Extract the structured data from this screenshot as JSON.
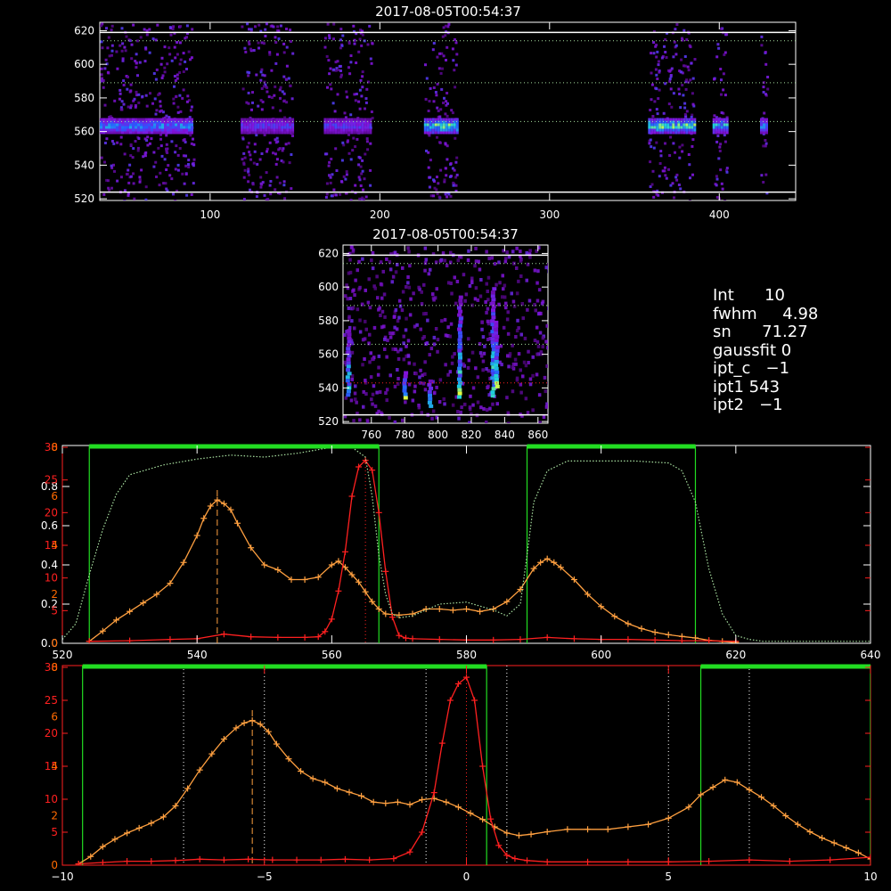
{
  "colors": {
    "background": "#000000",
    "axis": "#ffffff",
    "axis_red": "#ff2020",
    "axis_orange": "#ff6a00",
    "profile_orange": "#ffa040",
    "profile_red": "#ff2020",
    "filter_green": "#22dd22",
    "filter_dotted": "#a8e0a0"
  },
  "stats": [
    {
      "label": "Int",
      "value": "10",
      "text": "Int      10"
    },
    {
      "label": "fwhm",
      "value": "4.98",
      "text": "fwhm     4.98"
    },
    {
      "label": "sn",
      "value": "71.27",
      "text": "sn      71.27"
    },
    {
      "label": "gaussfit",
      "value": "0",
      "text": "gaussfit 0"
    },
    {
      "label": "ipt_c",
      "value": "-1",
      "text": "ipt_c   −1"
    },
    {
      "label": "ipt1",
      "value": "543",
      "text": "ipt1 543"
    },
    {
      "label": "ipt2",
      "value": "-1",
      "text": "ipt2   −1"
    }
  ],
  "chart_data": [
    {
      "id": "spectrogram-top",
      "type": "heatmap",
      "title": "2017-08-05T00:54:37",
      "xlim": [
        35,
        445
      ],
      "ylim": [
        519,
        625
      ],
      "x_ticks": [
        "100",
        "200",
        "300",
        "400"
      ],
      "x_tick_values": [
        100,
        200,
        300,
        400
      ],
      "y_ticks": [
        "520",
        "540",
        "560",
        "580",
        "600",
        "620"
      ],
      "y_tick_values": [
        520,
        540,
        560,
        580,
        600,
        620
      ],
      "bright_band_y": [
        560,
        568
      ],
      "blocks": [
        {
          "x": [
            35,
            90
          ],
          "intensity": 0.7
        },
        {
          "x": [
            118,
            148
          ],
          "intensity": 0.5
        },
        {
          "x": [
            167,
            195
          ],
          "intensity": 0.5
        },
        {
          "x": [
            226,
            245
          ],
          "intensity": 0.9
        },
        {
          "x": [
            358,
            385
          ],
          "intensity": 0.9
        },
        {
          "x": [
            396,
            404
          ],
          "intensity": 0.8
        },
        {
          "x": [
            424,
            428
          ],
          "intensity": 0.7
        }
      ],
      "guide_lines_y": [
        589,
        566,
        614
      ],
      "white_lines_y": [
        524,
        619
      ]
    },
    {
      "id": "spectrogram-small",
      "type": "heatmap",
      "title": "2017-08-05T00:54:37",
      "xlim": [
        743,
        866
      ],
      "ylim": [
        519,
        625
      ],
      "x_ticks": [
        "760",
        "780",
        "800",
        "820",
        "840",
        "860"
      ],
      "x_tick_values": [
        760,
        780,
        800,
        820,
        840,
        860
      ],
      "y_ticks": [
        "520",
        "540",
        "560",
        "580",
        "600",
        "620"
      ],
      "y_tick_values": [
        520,
        540,
        560,
        580,
        600,
        620
      ],
      "streaks": [
        {
          "x": 746,
          "y": [
            535,
            575
          ]
        },
        {
          "x": 780,
          "y": [
            535,
            550
          ]
        },
        {
          "x": 795,
          "y": [
            530,
            545
          ]
        },
        {
          "x": 813,
          "y": [
            535,
            595
          ]
        },
        {
          "x": 833,
          "y": [
            535,
            600
          ]
        },
        {
          "x": 835,
          "y": [
            540,
            580
          ]
        }
      ],
      "guide_lines_y": [
        589,
        566,
        614
      ],
      "white_lines_y": [
        524,
        619
      ]
    },
    {
      "id": "profile-wavelength",
      "type": "line",
      "xlim": [
        520,
        640
      ],
      "x_ticks": [
        "520",
        "540",
        "560",
        "580",
        "600",
        "620",
        "640"
      ],
      "x_tick_values": [
        520,
        540,
        560,
        580,
        600,
        620,
        640
      ],
      "y_left_black_ticks": [
        "0.0",
        "0.2",
        "0.4",
        "0.6",
        "0.8"
      ],
      "y_left_black_values": [
        0.0,
        0.2,
        0.4,
        0.6,
        0.8
      ],
      "y_left_black_range": [
        0,
        1.0
      ],
      "y_left_red_ticks": [
        "5",
        "10",
        "15",
        "20",
        "25",
        "30"
      ],
      "y_left_red_values": [
        5,
        10,
        15,
        20,
        25,
        30
      ],
      "y_left_red_range": [
        0,
        30
      ],
      "y_left_orange_ticks": [
        "0",
        "2",
        "4",
        "6",
        "8"
      ],
      "y_left_orange_values": [
        0,
        2,
        4,
        6,
        8
      ],
      "y_left_orange_range": [
        0,
        8
      ],
      "filter_bands": [
        [
          524,
          567
        ],
        [
          589,
          614
        ]
      ],
      "marker_dashed_x": 543,
      "marker_dotted_x": 565,
      "series": [
        {
          "id": "orange",
          "axis": "orange",
          "x": [
            524,
            526,
            528,
            530,
            532,
            534,
            536,
            538,
            540,
            541,
            542,
            543,
            544,
            545,
            546,
            548,
            550,
            552,
            554,
            556,
            558,
            560,
            561,
            562,
            563,
            564,
            565,
            566,
            567,
            568,
            570,
            572,
            574,
            576,
            578,
            580,
            582,
            584,
            586,
            588,
            590,
            591,
            592,
            593,
            594,
            596,
            598,
            600,
            602,
            604,
            606,
            608,
            610,
            612,
            614,
            616,
            618,
            620
          ],
          "y": [
            0.08,
            0.5,
            0.95,
            1.3,
            1.65,
            2.0,
            2.45,
            3.3,
            4.4,
            5.1,
            5.6,
            5.85,
            5.7,
            5.45,
            4.9,
            3.9,
            3.2,
            3.0,
            2.6,
            2.6,
            2.7,
            3.2,
            3.35,
            3.1,
            2.8,
            2.5,
            2.1,
            1.7,
            1.4,
            1.2,
            1.15,
            1.2,
            1.4,
            1.4,
            1.35,
            1.4,
            1.3,
            1.4,
            1.7,
            2.2,
            3.05,
            3.3,
            3.45,
            3.3,
            3.1,
            2.6,
            2.0,
            1.5,
            1.1,
            0.8,
            0.6,
            0.45,
            0.35,
            0.28,
            0.22,
            0.12,
            0.08,
            0.03
          ]
        },
        {
          "id": "red",
          "axis": "red",
          "x": [
            524,
            530,
            536,
            540,
            544,
            548,
            552,
            556,
            558,
            559,
            560,
            561,
            562,
            563,
            564,
            565,
            566,
            567,
            568,
            569,
            570,
            571,
            572,
            576,
            580,
            584,
            588,
            592,
            596,
            600,
            604,
            608,
            612,
            616,
            620
          ],
          "y": [
            0.3,
            0.4,
            0.6,
            0.7,
            1.4,
            1.0,
            0.9,
            0.9,
            1.0,
            1.8,
            3.7,
            8.0,
            14.0,
            22.5,
            27.0,
            28.0,
            26.5,
            20.0,
            11.0,
            4.0,
            1.2,
            0.8,
            0.7,
            0.6,
            0.5,
            0.5,
            0.6,
            0.9,
            0.7,
            0.6,
            0.6,
            0.5,
            0.4,
            0.4,
            0.3
          ]
        },
        {
          "id": "filter-transmission",
          "axis": "black",
          "x": [
            520,
            522,
            524,
            526,
            528,
            530,
            535,
            540,
            545,
            550,
            555,
            560,
            563,
            565,
            566,
            567,
            568,
            569,
            570,
            572,
            576,
            580,
            584,
            586,
            588,
            589,
            590,
            592,
            595,
            600,
            605,
            610,
            612,
            614,
            616,
            618,
            620,
            622,
            624,
            630,
            640
          ],
          "y": [
            0.02,
            0.1,
            0.35,
            0.58,
            0.76,
            0.86,
            0.91,
            0.94,
            0.96,
            0.95,
            0.97,
            1.0,
            1.0,
            0.95,
            0.75,
            0.45,
            0.25,
            0.15,
            0.13,
            0.14,
            0.2,
            0.21,
            0.17,
            0.14,
            0.2,
            0.45,
            0.72,
            0.88,
            0.93,
            0.93,
            0.93,
            0.92,
            0.88,
            0.72,
            0.38,
            0.15,
            0.04,
            0.02,
            0.01,
            0.01,
            0.01
          ]
        }
      ]
    },
    {
      "id": "profile-offset",
      "type": "line",
      "xlim": [
        -10,
        10
      ],
      "x_ticks": [
        "−10",
        "−5",
        "0",
        "5",
        "10"
      ],
      "x_tick_values": [
        -10,
        -5,
        0,
        5,
        10
      ],
      "y_left_red_ticks": [
        "5",
        "10",
        "15",
        "20",
        "25",
        "30"
      ],
      "y_left_red_values": [
        5,
        10,
        15,
        20,
        25,
        30
      ],
      "y_left_red_range": [
        0,
        30
      ],
      "y_left_orange_ticks": [
        "0",
        "2",
        "4",
        "6",
        "8"
      ],
      "y_left_orange_values": [
        0,
        2,
        4,
        6,
        8
      ],
      "y_left_orange_range": [
        0,
        8
      ],
      "filter_bands": [
        [
          -9.5,
          0.5
        ],
        [
          5.8,
          10
        ]
      ],
      "dotted_vlines_x": [
        -7,
        -5,
        -1,
        1,
        5,
        7
      ],
      "marker_dashed_x": -5.3,
      "marker_dotted_x": 0,
      "series": [
        {
          "id": "orange",
          "axis": "orange",
          "x": [
            -9.6,
            -9.3,
            -9.0,
            -8.7,
            -8.4,
            -8.1,
            -7.8,
            -7.5,
            -7.2,
            -6.9,
            -6.6,
            -6.3,
            -6.0,
            -5.7,
            -5.5,
            -5.3,
            -5.1,
            -4.9,
            -4.7,
            -4.4,
            -4.1,
            -3.8,
            -3.5,
            -3.2,
            -2.9,
            -2.6,
            -2.3,
            -2.0,
            -1.7,
            -1.4,
            -1.1,
            -0.8,
            -0.5,
            -0.2,
            0.1,
            0.4,
            0.7,
            1.0,
            1.3,
            1.6,
            2.0,
            2.5,
            3.0,
            3.5,
            4.0,
            4.5,
            5.0,
            5.5,
            5.8,
            6.1,
            6.4,
            6.7,
            7.0,
            7.3,
            7.6,
            7.9,
            8.2,
            8.5,
            8.8,
            9.1,
            9.4,
            9.7,
            10.0
          ],
          "y": [
            0.05,
            0.35,
            0.75,
            1.05,
            1.3,
            1.5,
            1.7,
            1.95,
            2.4,
            3.1,
            3.85,
            4.5,
            5.1,
            5.55,
            5.75,
            5.85,
            5.7,
            5.4,
            4.9,
            4.3,
            3.8,
            3.5,
            3.35,
            3.1,
            2.95,
            2.8,
            2.55,
            2.5,
            2.55,
            2.45,
            2.65,
            2.7,
            2.55,
            2.35,
            2.1,
            1.85,
            1.55,
            1.3,
            1.2,
            1.25,
            1.35,
            1.45,
            1.45,
            1.45,
            1.55,
            1.65,
            1.9,
            2.35,
            2.85,
            3.15,
            3.45,
            3.35,
            3.05,
            2.75,
            2.4,
            2.0,
            1.65,
            1.35,
            1.1,
            0.9,
            0.7,
            0.5,
            0.25
          ]
        },
        {
          "id": "red",
          "axis": "red",
          "x": [
            -9.6,
            -9.0,
            -8.4,
            -7.8,
            -7.2,
            -6.6,
            -6.0,
            -5.4,
            -4.8,
            -4.2,
            -3.6,
            -3.0,
            -2.4,
            -1.8,
            -1.4,
            -1.1,
            -0.8,
            -0.6,
            -0.4,
            -0.2,
            0.0,
            0.2,
            0.4,
            0.6,
            0.8,
            1.0,
            1.2,
            1.5,
            2.0,
            3.0,
            4.0,
            5.0,
            6.0,
            7.0,
            8.0,
            9.0,
            10.0
          ],
          "y": [
            0.2,
            0.4,
            0.6,
            0.6,
            0.7,
            0.9,
            0.8,
            0.9,
            0.8,
            0.8,
            0.8,
            0.9,
            0.8,
            1.0,
            2.0,
            5.0,
            11.0,
            18.5,
            25.0,
            27.5,
            28.5,
            25.0,
            15.0,
            7.0,
            3.0,
            1.5,
            1.0,
            0.7,
            0.5,
            0.5,
            0.5,
            0.5,
            0.6,
            0.8,
            0.6,
            0.8,
            1.2
          ]
        }
      ]
    }
  ]
}
